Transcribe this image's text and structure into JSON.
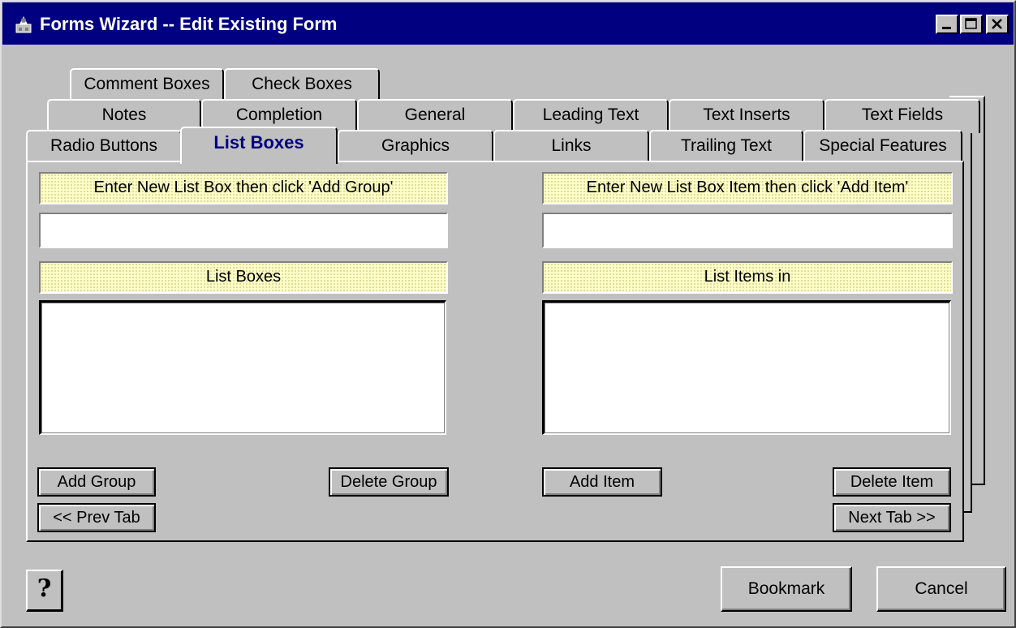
{
  "window": {
    "title": "Forms Wizard -- Edit Existing Form",
    "title_bar_color": "#000080"
  },
  "tabs": {
    "row1": [
      "Comment Boxes",
      "Check Boxes"
    ],
    "row2": [
      "Notes",
      "Completion",
      "General",
      "Leading Text",
      "Text Inserts",
      "Text Fields"
    ],
    "row3": [
      "Radio Buttons",
      "List Boxes",
      "Graphics",
      "Links",
      "Trailing Text",
      "Special Features"
    ],
    "active": "List Boxes",
    "active_color": "#000080"
  },
  "left": {
    "new_label": "Enter New List Box then click 'Add Group'",
    "new_value": "",
    "list_label": "List Boxes",
    "list_items": [],
    "add_button": "Add Group",
    "delete_button": "Delete Group",
    "prev_button": "<< Prev Tab"
  },
  "right": {
    "new_label": "Enter New List Box Item then click 'Add Item'",
    "new_value": "",
    "list_label": "List Items in",
    "list_items": [],
    "add_button": "Add Item",
    "delete_button": "Delete Item",
    "next_button": "Next Tab >>"
  },
  "footer": {
    "help_icon": "question-mark-icon",
    "help_glyph": "?",
    "bookmark_button": "Bookmark",
    "cancel_button": "Cancel"
  },
  "colors": {
    "face": "#c0c0c0",
    "label_bg": "#ffffc8"
  }
}
